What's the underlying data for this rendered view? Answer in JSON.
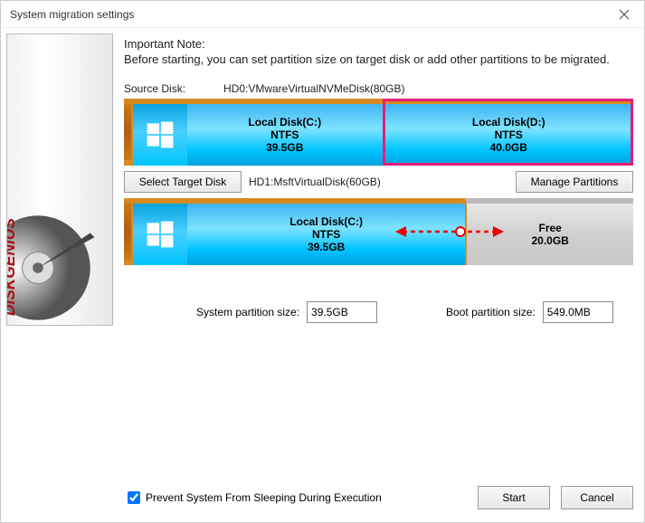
{
  "window": {
    "title": "System migration settings"
  },
  "note": {
    "title": "Important Note:",
    "text": "Before starting, you can set partition size on target disk or add other partitions to be migrated."
  },
  "source": {
    "label": "Source Disk:",
    "value": "HD0:VMwareVirtualNVMeDisk(80GB)",
    "partitions": [
      {
        "name": "Local Disk(C:)",
        "fs": "NTFS",
        "size": "39.5GB"
      },
      {
        "name": "Local Disk(D:)",
        "fs": "NTFS",
        "size": "40.0GB"
      }
    ]
  },
  "target": {
    "select_button": "Select Target Disk",
    "manage_button": "Manage Partitions",
    "value": "HD1:MsftVirtualDisk(60GB)",
    "partitions": [
      {
        "name": "Local Disk(C:)",
        "fs": "NTFS",
        "size": "39.5GB"
      },
      {
        "name": "Free",
        "fs": "",
        "size": "20.0GB"
      }
    ]
  },
  "inputs": {
    "system_label": "System partition size:",
    "system_value": "39.5GB",
    "boot_label": "Boot partition size:",
    "boot_value": "549.0MB"
  },
  "footer": {
    "prevent_sleep": "Prevent System From Sleeping During Execution",
    "start": "Start",
    "cancel": "Cancel"
  },
  "brand": "DISKGENIUS"
}
